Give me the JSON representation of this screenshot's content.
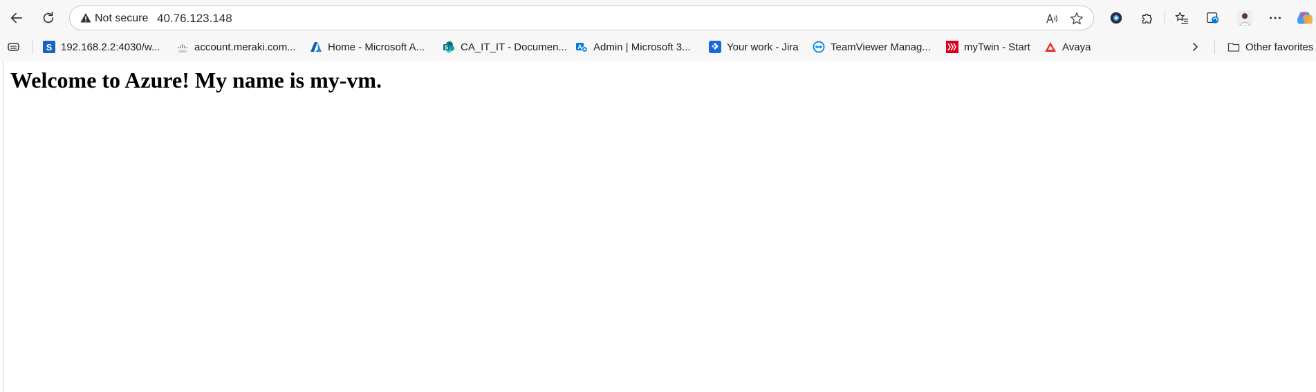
{
  "address_bar": {
    "security_label": "Not secure",
    "url": "40.76.123.148"
  },
  "bookmarks": [
    {
      "label": "192.168.2.2:4030/w...",
      "icon": "s-square-icon"
    },
    {
      "label": "account.meraki.com...",
      "icon": "cisco-icon"
    },
    {
      "label": "Home - Microsoft A...",
      "icon": "azure-icon"
    },
    {
      "label": "CA_IT_IT - Documen...",
      "icon": "sharepoint-icon"
    },
    {
      "label": "Admin | Microsoft 3...",
      "icon": "microsoft365-admin-icon"
    },
    {
      "label": "Your work - Jira",
      "icon": "jira-icon"
    },
    {
      "label": "TeamViewer Manag...",
      "icon": "teamviewer-icon"
    },
    {
      "label": "myTwin - Start",
      "icon": "mytwin-icon"
    },
    {
      "label": "Avaya",
      "icon": "avaya-icon"
    }
  ],
  "other_favorites_label": "Other favorites",
  "page": {
    "heading": "Welcome to Azure! My name is my-vm."
  },
  "colors": {
    "chrome_bg": "#f7f7f7",
    "azure_blue": "#0078d4",
    "avaya_red": "#e4322b",
    "mytwin_red": "#d6001c",
    "sharepoint_teal": "#038387",
    "jira_blue": "#2684ff"
  }
}
